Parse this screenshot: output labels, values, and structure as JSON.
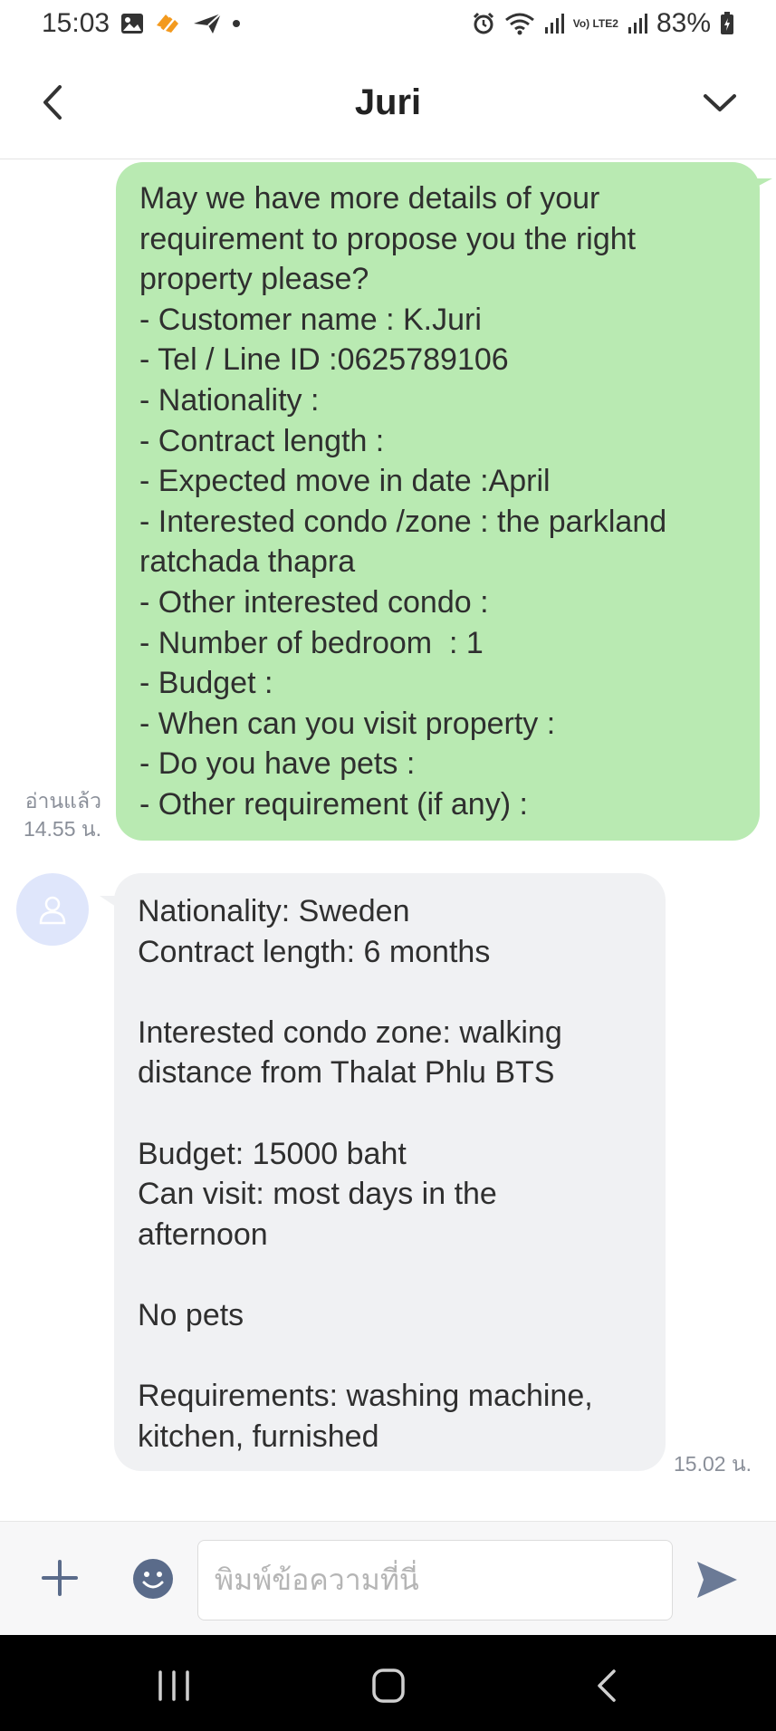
{
  "status_bar": {
    "time": "15:03",
    "battery": "83%",
    "network_label": "Vo) LTE2",
    "left_icons": [
      "gallery-icon",
      "app-notification-icon",
      "send-notification-icon",
      "more-dot-icon"
    ],
    "right_icons": [
      "alarm-icon",
      "wifi-icon",
      "signal-icon",
      "volte-icon",
      "signal-icon",
      "battery-icon"
    ]
  },
  "header": {
    "title": "Juri",
    "back_icon": "back-arrow-icon",
    "menu_icon": "chevron-down-icon"
  },
  "messages": [
    {
      "direction": "outgoing",
      "text": "May we have more details of your\nrequirement to propose you the right\nproperty please?\n- Customer name : K.Juri\n- Tel / Line ID :0625789106\n- Nationality :\n- Contract length :\n- Expected move in date :April\n- Interested condo /zone : the parkland\nratchada thapra\n- Other interested condo :\n- Number of bedroom  : 1\n- Budget :\n- When can you visit property :\n- Do you have pets :\n- Other requirement (if any) :",
      "read_label": "อ่านแล้ว",
      "time": "14.55 น."
    },
    {
      "direction": "incoming",
      "text": "Nationality: Sweden\nContract length: 6 months\n\nInterested condo zone: walking\ndistance from Thalat Phlu BTS\n\nBudget: 15000 baht\nCan visit: most days in the\nafternoon\n\nNo pets\n\nRequirements: washing machine,\nkitchen, furnished",
      "time": "15.02 น."
    }
  ],
  "input_bar": {
    "placeholder": "พิมพ์ข้อความที่นี่",
    "value": ""
  },
  "colors": {
    "outgoing_bubble": "#b9eab2",
    "incoming_bubble": "#f0f1f3",
    "avatar_bg": "#dfe6fb",
    "emoji_icon": "#5a6b8a",
    "send_icon": "#6b7a96",
    "nav_bar": "#000000"
  }
}
